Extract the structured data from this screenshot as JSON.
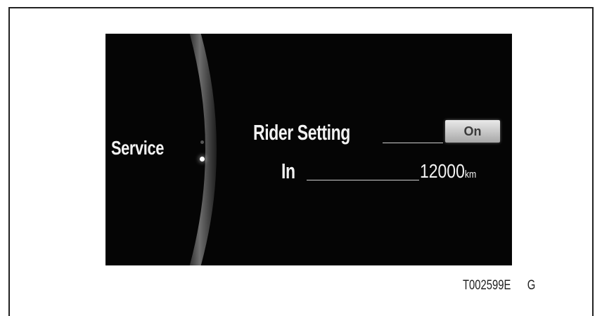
{
  "screen": {
    "menu_label": "Service",
    "rider_setting": {
      "label": "Rider Setting",
      "toggle_value": "On"
    },
    "interval": {
      "label": "In",
      "value": "12000",
      "unit": "km"
    }
  },
  "caption": {
    "figure_code": "T002599E",
    "suffix": "G"
  },
  "colors": {
    "screen_background": "#050505",
    "text": "#f2f2f2",
    "toggle": "#d9d9d9"
  }
}
